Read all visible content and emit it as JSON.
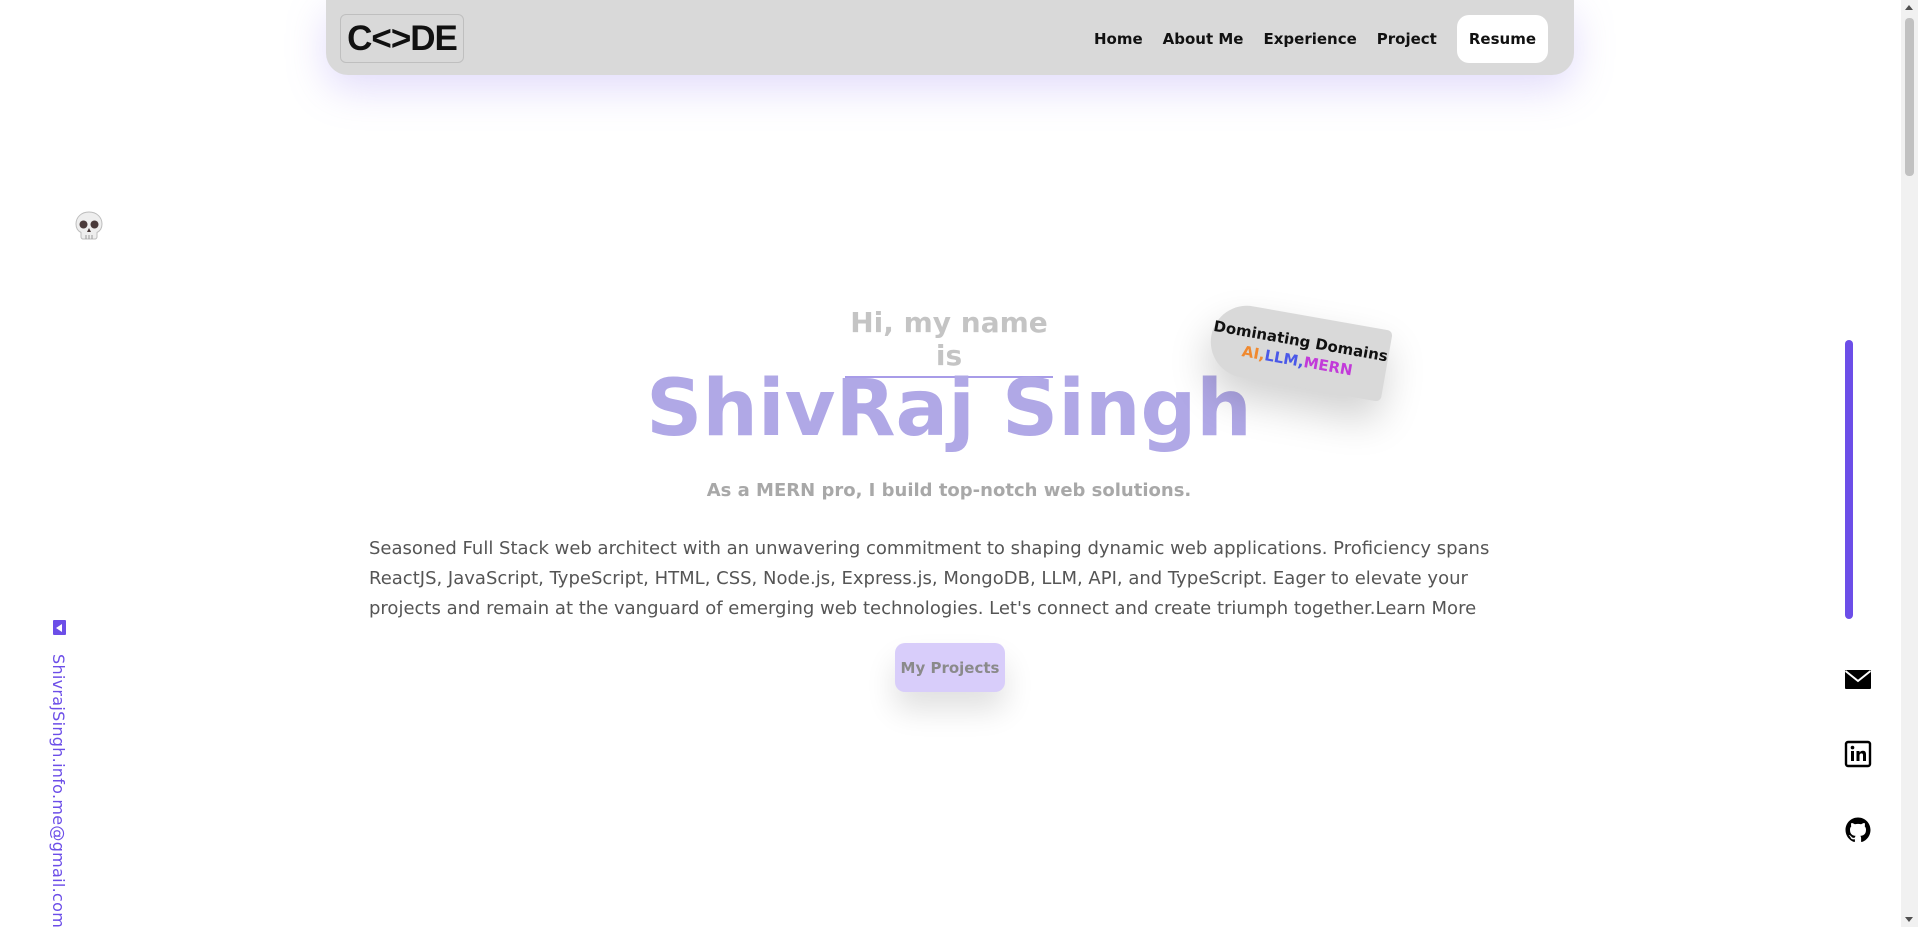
{
  "navbar": {
    "logo_text": "C<>DE",
    "links": [
      "Home",
      "About Me",
      "Experience",
      "Project"
    ],
    "resume_label": "Resume"
  },
  "hero": {
    "greeting": "Hi, my name is",
    "name": "ShivRaj Singh",
    "tagline": "As a MERN pro, I build top-notch web solutions.",
    "about": "Seasoned Full Stack web architect with an unwavering commitment to shaping dynamic web applications. Proficiency spans ReactJS, JavaScript, TypeScript, HTML, CSS, Node.js, Express.js, MongoDB, LLM, API, and TypeScript. Eager to elevate your projects and remain at the vanguard of emerging web technologies. Let's connect and create triumph together.",
    "learn_more": "Learn More",
    "projects_button": "My Projects"
  },
  "badge": {
    "title": "Dominating Domains",
    "domains": [
      "AI",
      "LLM",
      "MERN"
    ],
    "colors": {
      "AI": "#f0892f",
      "LLM": "#4a58e8",
      "MERN": "#c23ad9"
    }
  },
  "sidebar_left": {
    "email": "ShivrajSingh.info.me@gmail.com",
    "skull_icon": "skull-icon"
  },
  "sidebar_right": {
    "icons": [
      "mail-icon",
      "linkedin-icon",
      "github-icon"
    ]
  },
  "theme": {
    "accent": "#6c4ee8",
    "name_color": "#b0a8e6",
    "navbar_bg": "#d9d9d9"
  }
}
